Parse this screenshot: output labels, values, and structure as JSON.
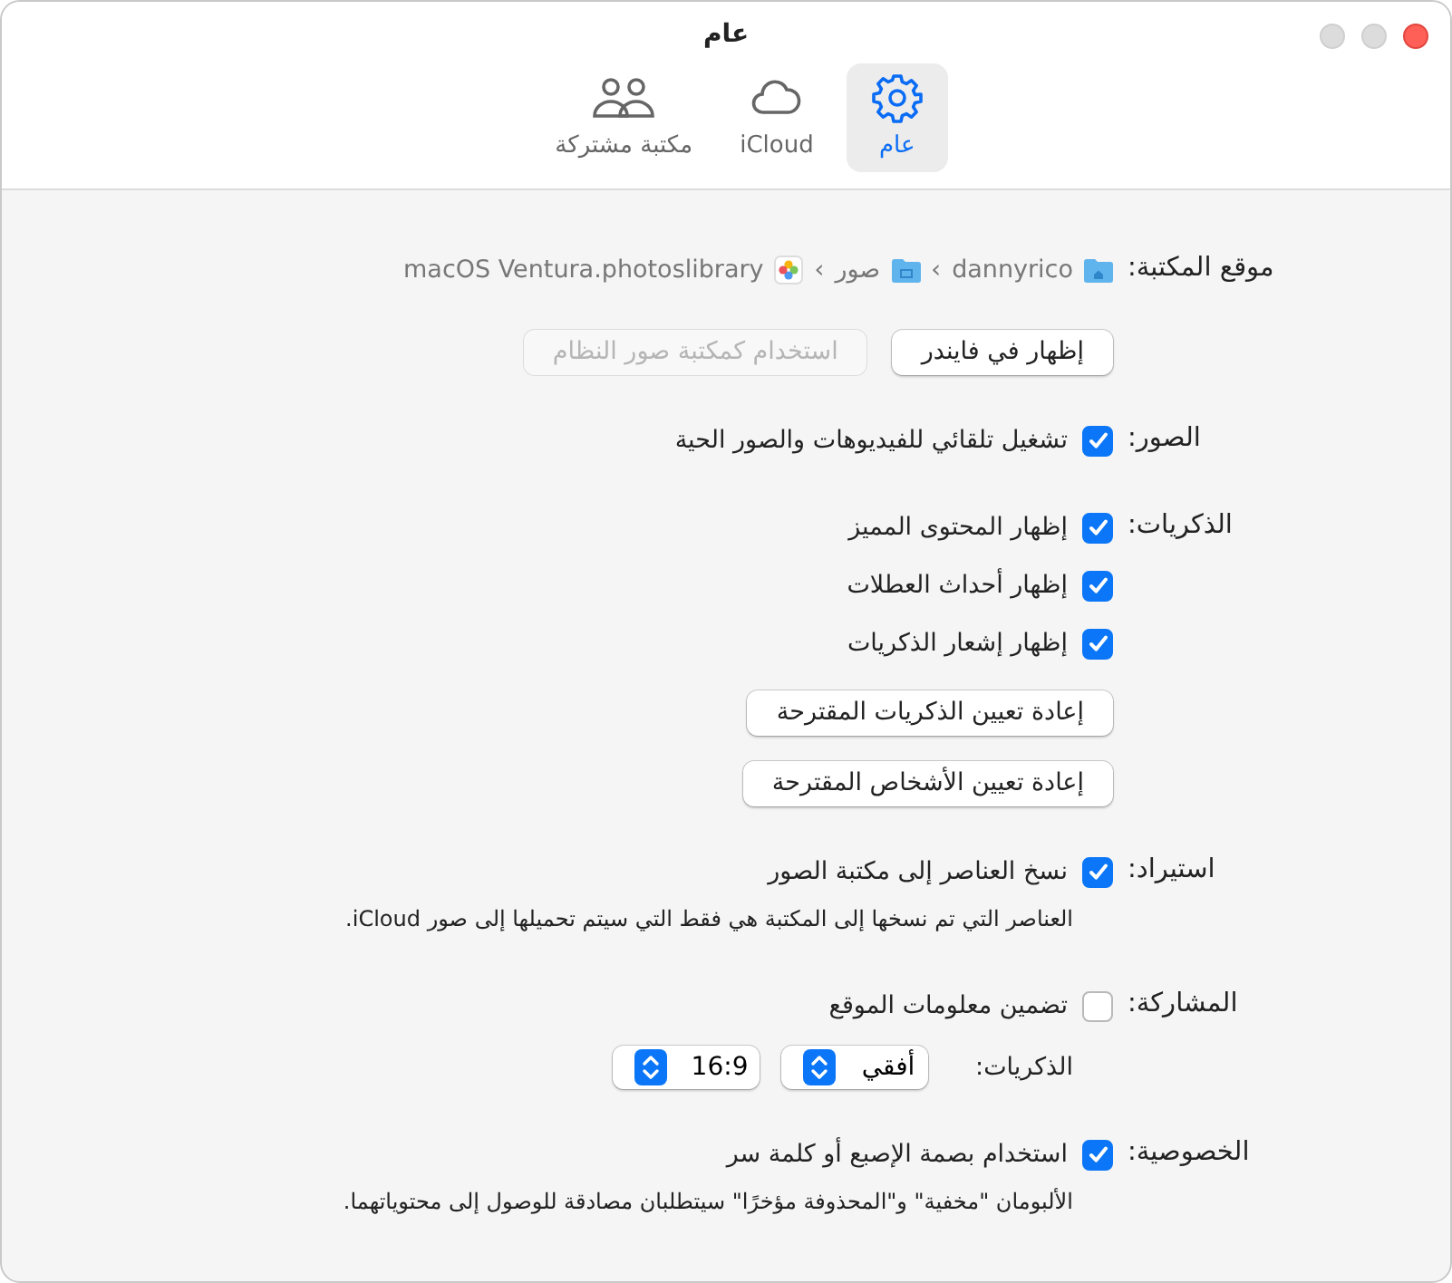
{
  "window": {
    "title": "عام"
  },
  "tabs": [
    {
      "label": "عام",
      "selected": true
    },
    {
      "label": "iCloud",
      "selected": false
    },
    {
      "label": "مكتبة مشتركة",
      "selected": false
    }
  ],
  "rows": [
    {
      "kind": "path",
      "label": "موقع المكتبة:",
      "items": [
        {
          "text": "dannyrico"
        },
        {
          "separator": "›"
        },
        {
          "text": "صور"
        },
        {
          "separator": "›"
        },
        {
          "text": "macOS Ventura.photoslibrary"
        }
      ]
    },
    {
      "kind": "buttons",
      "buttons": [
        {
          "label": "إظهار في فايندر",
          "disabled": false
        },
        {
          "label": "استخدام كمكتبة صور النظام",
          "disabled": true
        }
      ]
    },
    {
      "kind": "checkbox",
      "label": "الصور:",
      "text": "تشغيل تلقائي للفيديوهات والصور الحية",
      "checked": true
    },
    {
      "kind": "checkbox",
      "label": "الذكريات:",
      "text": "إظهار المحتوى المميز",
      "checked": true
    },
    {
      "kind": "checkbox",
      "text": "إظهار أحداث العطلات",
      "checked": true
    },
    {
      "kind": "checkbox",
      "text": "إظهار إشعار الذكريات",
      "checked": true
    },
    {
      "kind": "buttons",
      "buttons": [
        {
          "label": "إعادة تعيين الذكريات المقترحة",
          "disabled": false
        }
      ]
    },
    {
      "kind": "buttons",
      "buttons": [
        {
          "label": "إعادة تعيين الأشخاص المقترحة",
          "disabled": false
        }
      ]
    },
    {
      "kind": "checkbox",
      "label": "استيراد:",
      "text": "نسخ العناصر إلى مكتبة الصور",
      "checked": true
    },
    {
      "kind": "note",
      "text": "العناصر التي تم نسخها إلى المكتبة هي فقط التي سيتم تحميلها إلى صور iCloud."
    },
    {
      "kind": "checkbox",
      "label": "المشاركة:",
      "text": "تضمين معلومات الموقع",
      "checked": false
    },
    {
      "kind": "selects",
      "text": "الذكريات:",
      "selects": [
        {
          "value": "أفقي"
        },
        {
          "value": "16:9"
        }
      ]
    },
    {
      "kind": "checkbox",
      "label": "الخصوصية:",
      "text": "استخدام بصمة الإصبع أو كلمة سر",
      "checked": true
    },
    {
      "kind": "note",
      "text": "الألبومان \"مخفية\" و\"المحذوفة مؤخرًا\" سيتطلبان مصادقة للوصول إلى محتوياتهما."
    }
  ]
}
